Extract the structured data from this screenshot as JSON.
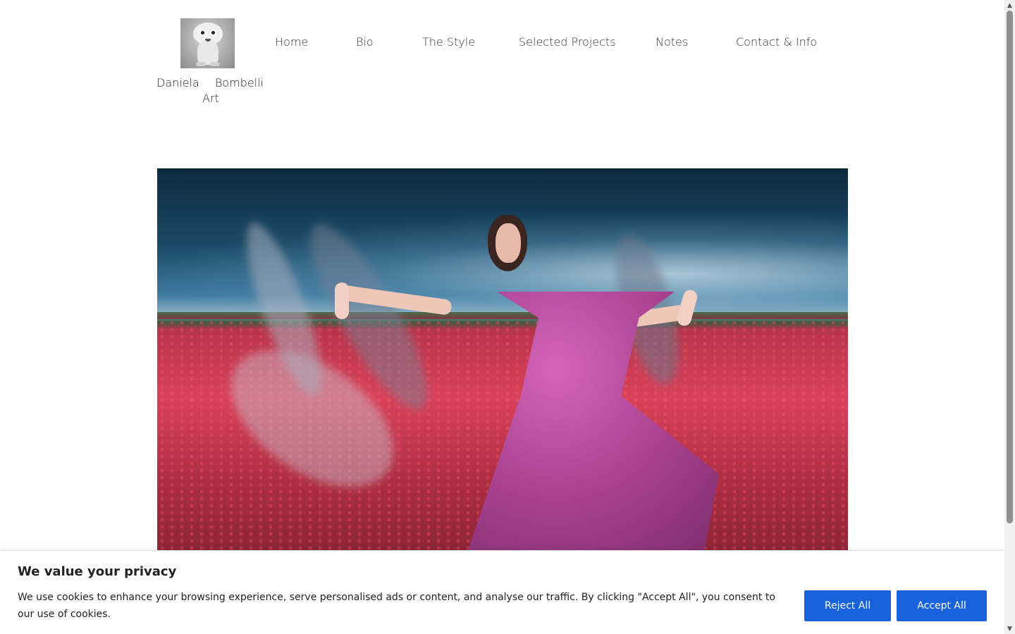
{
  "brand": {
    "name_first": "Daniela",
    "name_last": "Bombelli",
    "name_suffix": "Art",
    "logo_icon": "mascot-logo-icon"
  },
  "nav": {
    "items": [
      {
        "label": "Home"
      },
      {
        "label": "Bio"
      },
      {
        "label": "The Style"
      },
      {
        "label": "Selected Projects"
      },
      {
        "label": "Notes"
      },
      {
        "label": "Contact & Info"
      }
    ]
  },
  "hero": {
    "image": "woman-in-poppy-field-image"
  },
  "cookie": {
    "title": "We value your privacy",
    "text": "We use cookies to enhance your browsing experience, serve personalised ads or content, and analyse our traffic. By clicking \"Accept All\", you consent to our use of cookies.",
    "reject_label": "Reject All",
    "accept_label": "Accept All",
    "button_color": "#1863dc"
  },
  "scrollbar": {
    "up_icon": "▲",
    "down_icon": "▼"
  }
}
